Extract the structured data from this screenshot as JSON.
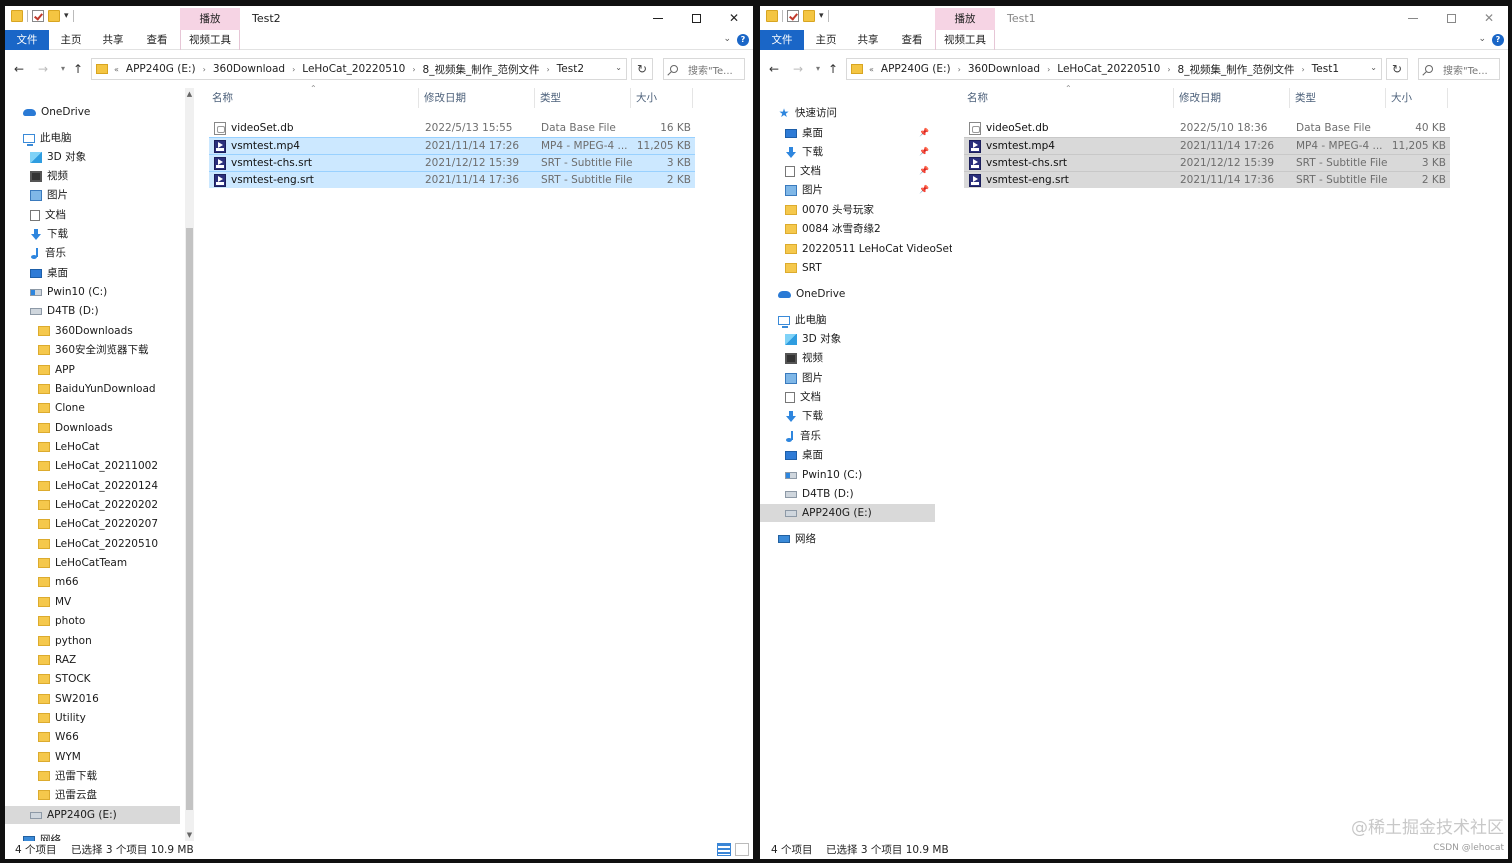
{
  "colors": {
    "accent": "#1a66c7",
    "context_tab": "#f6d4e4",
    "selection": "#cce8ff",
    "inactive_selection": "#d9d9d9",
    "folder": "#f5c84c"
  },
  "ribbon": {
    "file": "文件",
    "home": "主页",
    "share": "共享",
    "view": "查看",
    "play": "播放",
    "video_tools": "视频工具"
  },
  "columns": {
    "name": "名称",
    "date": "修改日期",
    "type": "类型",
    "size": "大小"
  },
  "search_placeholder": "搜索\"Te...",
  "window_a": {
    "title": "Test2",
    "breadcrumb": [
      "APP240G (E:)",
      "360Download",
      "LeHoCat_20220510",
      "8_视频集_制作_范例文件",
      "Test2"
    ],
    "nav_items": [
      {
        "label": "OneDrive",
        "icon": "onedrive-icon"
      },
      {
        "label": "此电脑",
        "icon": "pc-icon"
      },
      {
        "label": "3D 对象",
        "icon": "3d-objects-icon"
      },
      {
        "label": "视频",
        "icon": "video-icon"
      },
      {
        "label": "图片",
        "icon": "pictures-icon"
      },
      {
        "label": "文档",
        "icon": "documents-icon"
      },
      {
        "label": "下载",
        "icon": "download-icon"
      },
      {
        "label": "音乐",
        "icon": "music-icon"
      },
      {
        "label": "桌面",
        "icon": "desktop-icon"
      },
      {
        "label": "Pwin10 (C:)",
        "icon": "system-drive-icon"
      },
      {
        "label": "D4TB (D:)",
        "icon": "drive-icon"
      },
      {
        "label": "360Downloads",
        "icon": "folder-icon"
      },
      {
        "label": "360安全浏览器下载",
        "icon": "folder-icon"
      },
      {
        "label": "APP",
        "icon": "folder-icon"
      },
      {
        "label": "BaiduYunDownload",
        "icon": "folder-icon"
      },
      {
        "label": "Clone",
        "icon": "folder-icon"
      },
      {
        "label": "Downloads",
        "icon": "folder-icon"
      },
      {
        "label": "LeHoCat",
        "icon": "folder-icon"
      },
      {
        "label": "LeHoCat_20211002",
        "icon": "folder-icon"
      },
      {
        "label": "LeHoCat_20220124",
        "icon": "folder-icon"
      },
      {
        "label": "LeHoCat_20220202",
        "icon": "folder-icon"
      },
      {
        "label": "LeHoCat_20220207",
        "icon": "folder-icon"
      },
      {
        "label": "LeHoCat_20220510",
        "icon": "folder-icon"
      },
      {
        "label": "LeHoCatTeam",
        "icon": "folder-icon"
      },
      {
        "label": "m66",
        "icon": "folder-icon"
      },
      {
        "label": "MV",
        "icon": "folder-icon"
      },
      {
        "label": "photo",
        "icon": "folder-icon"
      },
      {
        "label": "python",
        "icon": "folder-icon"
      },
      {
        "label": "RAZ",
        "icon": "folder-icon"
      },
      {
        "label": "STOCK",
        "icon": "folder-icon"
      },
      {
        "label": "SW2016",
        "icon": "folder-icon"
      },
      {
        "label": "Utility",
        "icon": "folder-icon"
      },
      {
        "label": "W66",
        "icon": "folder-icon"
      },
      {
        "label": "WYM",
        "icon": "folder-icon"
      },
      {
        "label": "迅雷下载",
        "icon": "folder-icon"
      },
      {
        "label": "迅雷云盘",
        "icon": "folder-icon"
      },
      {
        "label": "APP240G (E:)",
        "icon": "drive-icon"
      },
      {
        "label": "网络",
        "icon": "network-icon"
      }
    ],
    "files": [
      {
        "name": "videoSet.db",
        "date": "2022/5/13 15:55",
        "type": "Data Base File",
        "size": "16 KB",
        "icon": "db-file-icon"
      },
      {
        "name": "vsmtest.mp4",
        "date": "2021/11/14 17:26",
        "type": "MP4 - MPEG-4 ...",
        "size": "11,205 KB",
        "icon": "mp4-file-icon"
      },
      {
        "name": "vsmtest-chs.srt",
        "date": "2021/12/12 15:39",
        "type": "SRT - Subtitle File",
        "size": "3 KB",
        "icon": "srt-file-icon"
      },
      {
        "name": "vsmtest-eng.srt",
        "date": "2021/11/14 17:36",
        "type": "SRT - Subtitle File",
        "size": "2 KB",
        "icon": "srt-file-icon"
      }
    ],
    "status_count": "4 个项目",
    "status_selected": "已选择 3 个项目  10.9 MB"
  },
  "window_b": {
    "title": "Test1",
    "breadcrumb": [
      "APP240G (E:)",
      "360Download",
      "LeHoCat_20220510",
      "8_视频集_制作_范例文件",
      "Test1"
    ],
    "nav_items": [
      {
        "label": "快速访问",
        "icon": "quick-access-icon"
      },
      {
        "label": "桌面",
        "icon": "desktop-icon"
      },
      {
        "label": "下载",
        "icon": "download-icon"
      },
      {
        "label": "文档",
        "icon": "documents-icon"
      },
      {
        "label": "图片",
        "icon": "pictures-icon"
      },
      {
        "label": "0070 头号玩家",
        "icon": "folder-icon"
      },
      {
        "label": "0084 冰雪奇缘2",
        "icon": "folder-icon"
      },
      {
        "label": "20220511 LeHoCat VideoSet",
        "icon": "folder-icon"
      },
      {
        "label": "SRT",
        "icon": "folder-icon"
      },
      {
        "label": "OneDrive",
        "icon": "onedrive-icon"
      },
      {
        "label": "此电脑",
        "icon": "pc-icon"
      },
      {
        "label": "3D 对象",
        "icon": "3d-objects-icon"
      },
      {
        "label": "视频",
        "icon": "video-icon"
      },
      {
        "label": "图片",
        "icon": "pictures-icon"
      },
      {
        "label": "文档",
        "icon": "documents-icon"
      },
      {
        "label": "下载",
        "icon": "download-icon"
      },
      {
        "label": "音乐",
        "icon": "music-icon"
      },
      {
        "label": "桌面",
        "icon": "desktop-icon"
      },
      {
        "label": "Pwin10 (C:)",
        "icon": "system-drive-icon"
      },
      {
        "label": "D4TB (D:)",
        "icon": "drive-icon"
      },
      {
        "label": "APP240G (E:)",
        "icon": "drive-icon"
      },
      {
        "label": "网络",
        "icon": "network-icon"
      }
    ],
    "files": [
      {
        "name": "videoSet.db",
        "date": "2022/5/10 18:36",
        "type": "Data Base File",
        "size": "40 KB",
        "icon": "db-file-icon"
      },
      {
        "name": "vsmtest.mp4",
        "date": "2021/11/14 17:26",
        "type": "MP4 - MPEG-4 ...",
        "size": "11,205 KB",
        "icon": "mp4-file-icon"
      },
      {
        "name": "vsmtest-chs.srt",
        "date": "2021/12/12 15:39",
        "type": "SRT - Subtitle File",
        "size": "3 KB",
        "icon": "srt-file-icon"
      },
      {
        "name": "vsmtest-eng.srt",
        "date": "2021/11/14 17:36",
        "type": "SRT - Subtitle File",
        "size": "2 KB",
        "icon": "srt-file-icon"
      }
    ],
    "status_count": "4 个项目",
    "status_selected": "已选择 3 个项目  10.9 MB"
  },
  "watermark": "@稀土掘金技术社区",
  "watermark_small": "CSDN @lehocat"
}
